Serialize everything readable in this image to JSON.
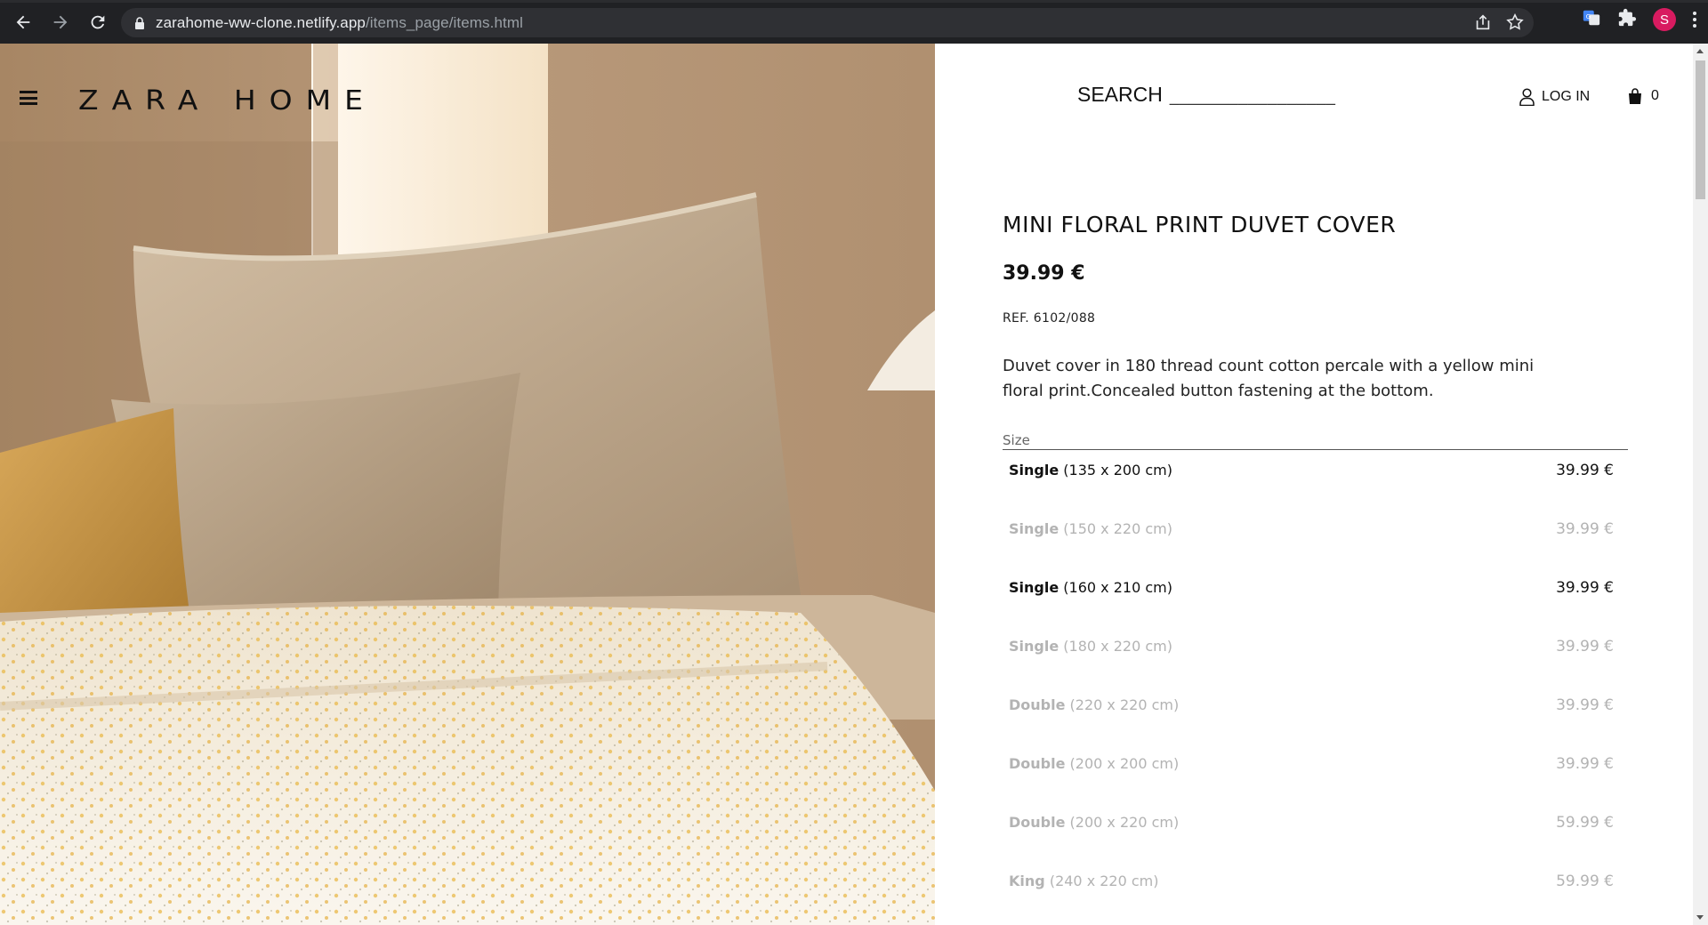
{
  "browser": {
    "url_host": "zarahome-ww-clone.netlify.app",
    "url_path": "/items_page/items.html",
    "profile_initial": "S",
    "icons": [
      "back-icon",
      "forward-icon",
      "reload-icon",
      "lock-icon",
      "share-icon",
      "bookmark-star-icon",
      "translate-extension-icon",
      "puzzle-extension-icon",
      "profile-avatar",
      "kebab-menu-icon"
    ]
  },
  "header": {
    "logo": "ZARA HOME",
    "search_label": "SEARCH",
    "search_line": "_________________",
    "login_label": "LOG IN",
    "cart_count": "0"
  },
  "product": {
    "title": "MINI FLORAL PRINT DUVET COVER",
    "price": "39.99 €",
    "ref": "REF. 6102/088",
    "description": "Duvet cover in 180 thread count cotton percale with a yellow mini floral print.Concealed button fastening at the bottom.",
    "size_heading": "Size",
    "sizes": [
      {
        "name": "Single",
        "dims": "(135 x 200 cm)",
        "price": "39.99 €",
        "available": true
      },
      {
        "name": "Single",
        "dims": "(150 x 220 cm)",
        "price": "39.99 €",
        "available": false
      },
      {
        "name": "Single",
        "dims": "(160 x 210 cm)",
        "price": "39.99 €",
        "available": true
      },
      {
        "name": "Single",
        "dims": "(180 x 220 cm)",
        "price": "39.99 €",
        "available": false
      },
      {
        "name": "Double",
        "dims": "(220 x 220 cm)",
        "price": "39.99 €",
        "available": false
      },
      {
        "name": "Double",
        "dims": "(200 x 200 cm)",
        "price": "39.99 €",
        "available": false
      },
      {
        "name": "Double",
        "dims": "(200 x 220 cm)",
        "price": "59.99 €",
        "available": false
      },
      {
        "name": "King",
        "dims": "(240 x 220 cm)",
        "price": "59.99 €",
        "available": false
      }
    ]
  },
  "colors": {
    "chrome_bg": "#202124",
    "omnibox_bg": "#2f3034",
    "text_primary": "#111111",
    "text_unavailable": "#b3b3b3",
    "avatar": "#d81b60"
  }
}
